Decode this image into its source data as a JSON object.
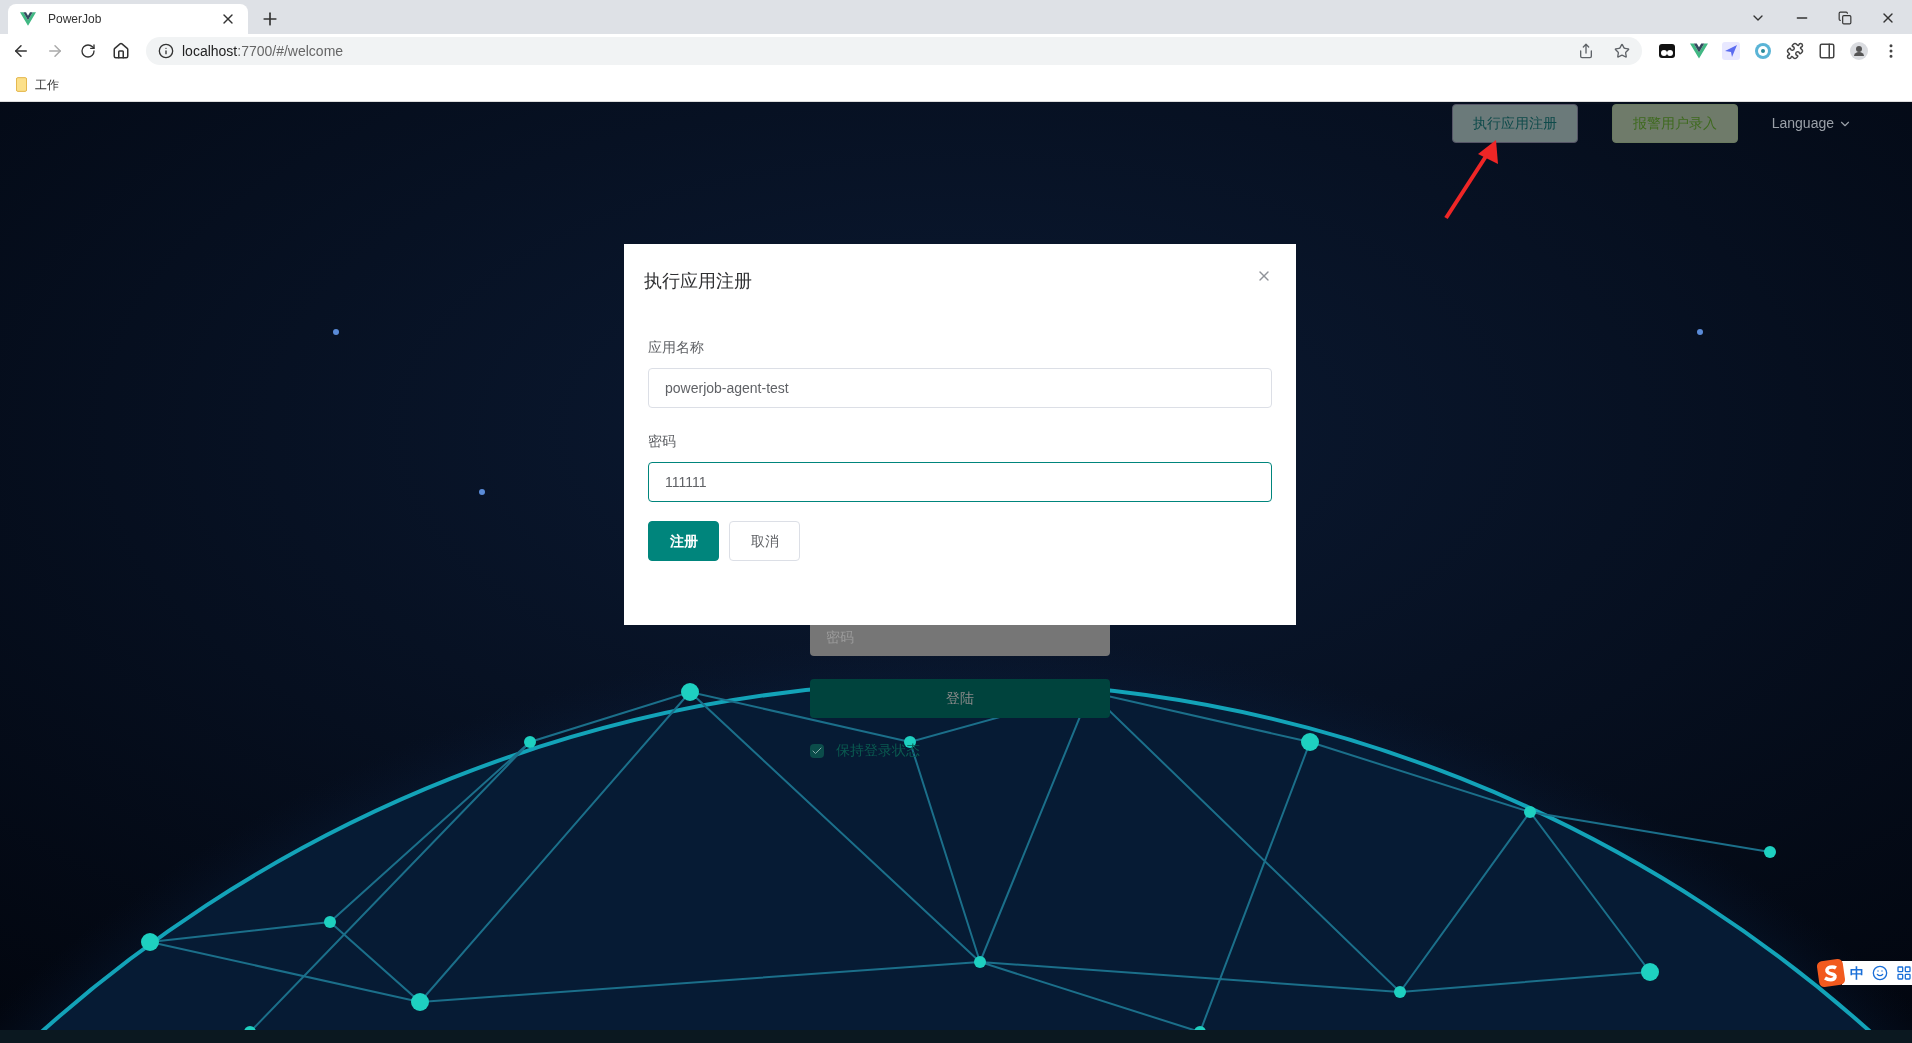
{
  "browser": {
    "tab": {
      "title": "PowerJob"
    },
    "address": {
      "host": "localhost",
      "path": ":7700/#/welcome"
    },
    "bookmarks": [
      {
        "label": "工作"
      }
    ]
  },
  "header": {
    "buttons": [
      {
        "label": "执行应用注册",
        "kind": "info"
      },
      {
        "label": "报警用户录入",
        "kind": "success"
      }
    ],
    "language": "Language"
  },
  "login": {
    "password_placeholder": "密码",
    "submit": "登陆",
    "remember": {
      "label": "保持登录状态",
      "checked": true
    }
  },
  "dialog": {
    "title": "执行应用注册",
    "fields": [
      {
        "label": "应用名称",
        "value": "powerjob-agent-test",
        "focused": false
      },
      {
        "label": "密码",
        "value": "111111",
        "focused": true
      }
    ],
    "buttons": [
      {
        "label": "注册",
        "kind": "primary"
      },
      {
        "label": "取消",
        "kind": "default"
      }
    ]
  },
  "ime": {
    "mode": "中"
  }
}
